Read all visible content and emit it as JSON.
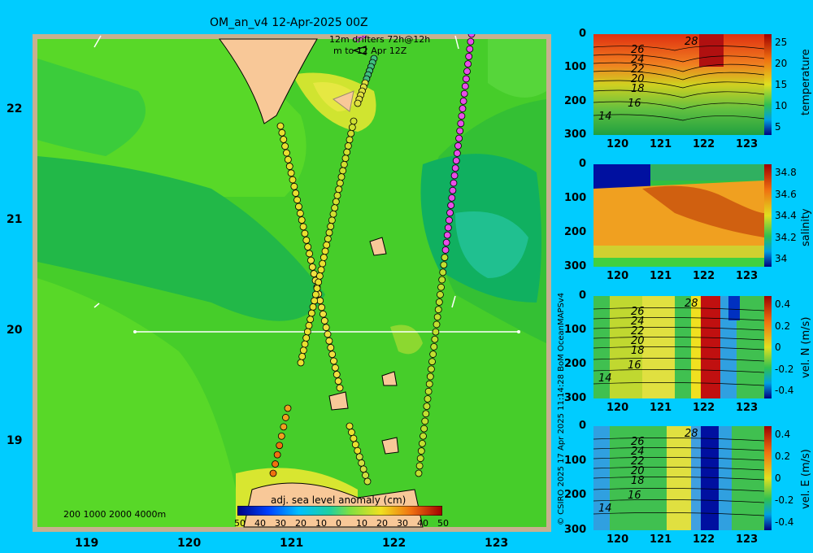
{
  "title": "OM_an_v4  12-Apr-2025 00Z",
  "drifters_legend": {
    "line1": "12m  drifters 72h@12h",
    "line2": "m      to 12 Apr 12Z"
  },
  "depth_contours_legend": "200  1000  2000  4000m",
  "sla_colorbar": {
    "title": "adj. sea level anomaly (cm)",
    "ticks": [
      "50",
      "40",
      "30",
      "20",
      "10",
      "0",
      "10",
      "20",
      "30",
      "40",
      "50"
    ]
  },
  "map_axes": {
    "lon_ticks": [
      "119",
      "120",
      "121",
      "122",
      "123"
    ],
    "lat_ticks": [
      "22",
      "21",
      "20",
      "19"
    ]
  },
  "credit": "© CSIRO 2025   17 Apr 2025 11:14:28 BoM OceanMAPSv4",
  "panels": [
    {
      "id": "temperature",
      "label": "temperature",
      "cbar_ticks": [
        "25",
        "20",
        "15",
        "10",
        "5"
      ],
      "contour_labels": [
        "28",
        "26",
        "24",
        "22",
        "20",
        "18",
        "16",
        "14"
      ]
    },
    {
      "id": "salinity",
      "label": "salinity",
      "cbar_ticks": [
        "34.8",
        "34.6",
        "34.4",
        "34.2",
        "34"
      ],
      "contour_labels": []
    },
    {
      "id": "vel-n",
      "label": "vel. N (m/s)",
      "cbar_ticks": [
        "0.4",
        "0.2",
        "0",
        "-0.2",
        "-0.4"
      ],
      "contour_labels": [
        "28",
        "26",
        "24",
        "22",
        "20",
        "18",
        "16",
        "14"
      ]
    },
    {
      "id": "vel-e",
      "label": "vel. E (m/s)",
      "cbar_ticks": [
        "0.4",
        "0.2",
        "0",
        "-0.2",
        "-0.4"
      ],
      "contour_labels": [
        "28",
        "26",
        "24",
        "22",
        "20",
        "18",
        "16",
        "14"
      ]
    }
  ],
  "panel_axes": {
    "depth_ticks": [
      "0",
      "100",
      "200",
      "300"
    ],
    "lon_ticks": [
      "120",
      "121",
      "122",
      "123"
    ]
  },
  "colors": {
    "background": "#00ccff",
    "land": "#f8c898",
    "coast": "#c8b090"
  }
}
